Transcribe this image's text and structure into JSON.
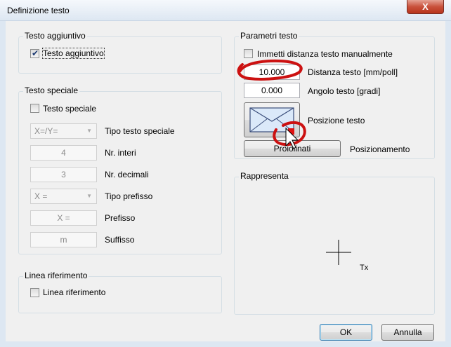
{
  "window": {
    "title": "Definizione testo",
    "close_label": "X"
  },
  "testo_aggiuntivo": {
    "group_title": "Testo aggiuntivo",
    "checkbox_label": "Testo aggiuntivo",
    "checked": true
  },
  "testo_speciale": {
    "group_title": "Testo speciale",
    "checkbox_label": "Testo speciale",
    "tipo_combo_value": "X=/Y=",
    "tipo_label": "Tipo testo speciale",
    "nr_interi_value": "4",
    "nr_interi_label": "Nr. interi",
    "nr_decimali_value": "3",
    "nr_decimali_label": "Nr. decimali",
    "prefisso_combo_value": "X =",
    "tipo_prefisso_label": "Tipo prefisso",
    "prefisso_value": "X =",
    "prefisso_label": "Prefisso",
    "suffisso_value": "m",
    "suffisso_label": "Suffisso"
  },
  "linea_riferimento": {
    "group_title": "Linea riferimento",
    "checkbox_label": "Linea riferimento"
  },
  "parametri": {
    "group_title": "Parametri testo",
    "manual_label": "Immetti distanza testo manualmente",
    "distanza_value": "10.000",
    "distanza_label": "Distanza testo [mm/poll]",
    "angolo_value": "0.000",
    "angolo_label": "Angolo testo [gradi]",
    "posizione_label": "Posizione testo",
    "posizionamento_button_label": "Proiolinati",
    "posizionamento_label": "Posizionamento"
  },
  "rappresenta": {
    "group_title": "Rappresenta",
    "preview_text": "Tx"
  },
  "buttons": {
    "ok": "OK",
    "cancel": "Annulla"
  },
  "colors": {
    "annotation": "#cc1111",
    "annotation_dot": "#e01010"
  }
}
